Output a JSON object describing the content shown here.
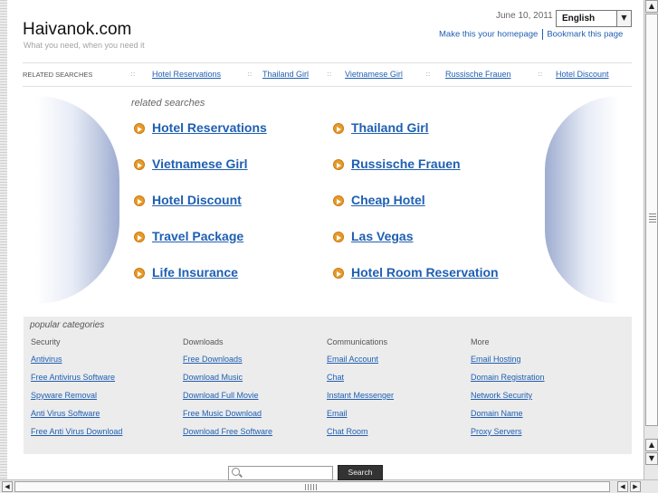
{
  "header": {
    "logo": "Haivanok.com",
    "tagline": "What you need, when you need it",
    "date": "June 10, 2011",
    "language": "English",
    "homepage_link": "Make this your homepage",
    "bookmark_link": "Bookmark this page"
  },
  "related_bar": {
    "label": "RELATED SEARCHES",
    "separator": "::",
    "items": [
      "Hotel Reservations",
      "Thailand Girl",
      "Vietnamese Girl",
      "Russische Frauen",
      "Hotel Discount"
    ]
  },
  "related_searches": {
    "title": "related searches",
    "left": [
      "Hotel Reservations",
      "Vietnamese Girl",
      "Hotel Discount",
      "Travel Package",
      "Life Insurance"
    ],
    "right": [
      "Thailand Girl",
      "Russische Frauen",
      "Cheap Hotel",
      "Las Vegas",
      "Hotel Room Reservation"
    ]
  },
  "popular": {
    "title": "popular categories",
    "columns": [
      {
        "header": "Security",
        "links": [
          "Antivirus",
          "Free Antivirus Software",
          "Spyware Removal",
          "Anti Virus Software",
          "Free Anti Virus Download"
        ]
      },
      {
        "header": "Downloads",
        "links": [
          "Free Downloads",
          "Download Music",
          "Download Full Movie",
          "Free Music Download",
          "Download Free Software"
        ]
      },
      {
        "header": "Communications",
        "links": [
          "Email Account",
          "Chat",
          "Instant Messenger",
          "Email",
          "Chat Room"
        ]
      },
      {
        "header": "More",
        "links": [
          "Email Hosting",
          "Domain Registration",
          "Network Security",
          "Domain Name",
          "Proxy Servers"
        ]
      }
    ]
  },
  "search": {
    "placeholder": "",
    "button": "Search"
  },
  "icons": {
    "bullet": "arrow-circle-icon",
    "search": "search-icon",
    "dropdown": "chevron-down-icon"
  },
  "colors": {
    "link": "#1f5fb2",
    "bullet": "#e89a2a",
    "panel": "#ececec"
  }
}
